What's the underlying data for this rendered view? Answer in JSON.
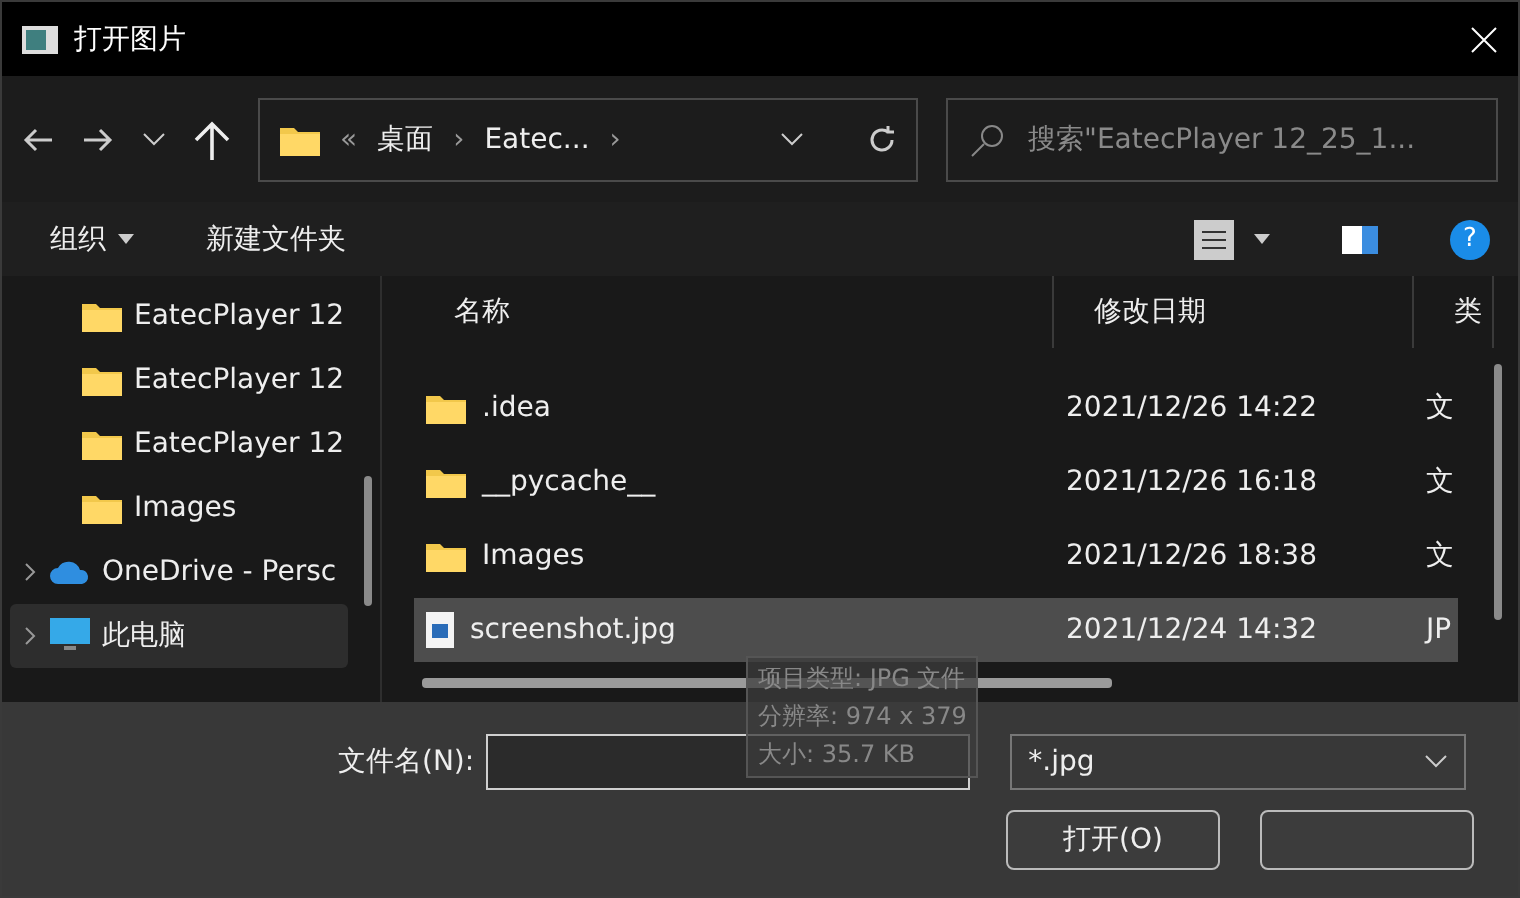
{
  "window": {
    "title": "打开图片"
  },
  "address": {
    "segments": [
      "«",
      "桌面",
      "›",
      "Eatec...",
      "›"
    ]
  },
  "search": {
    "placeholder": "搜索\"EatecPlayer 12_25_1..."
  },
  "toolbar": {
    "organize": "组织",
    "new_folder": "新建文件夹"
  },
  "sidebar": {
    "items": [
      {
        "kind": "folder",
        "label": "EatecPlayer 12",
        "selected": false
      },
      {
        "kind": "folder",
        "label": "EatecPlayer 12",
        "selected": false
      },
      {
        "kind": "folder",
        "label": "EatecPlayer 12",
        "selected": false
      },
      {
        "kind": "folder",
        "label": "Images",
        "selected": false
      },
      {
        "kind": "cloud",
        "label": "OneDrive - Persc",
        "selected": false
      },
      {
        "kind": "computer",
        "label": "此电脑",
        "selected": true
      }
    ]
  },
  "table": {
    "columns": [
      "名称",
      "修改日期",
      "类"
    ],
    "rows": [
      {
        "kind": "folder",
        "name": ".idea",
        "date": "2021/12/26 14:22",
        "type": "文",
        "selected": false
      },
      {
        "kind": "folder",
        "name": "__pycache__",
        "date": "2021/12/26 16:18",
        "type": "文",
        "selected": false
      },
      {
        "kind": "folder",
        "name": "Images",
        "date": "2021/12/26 18:38",
        "type": "文",
        "selected": false
      },
      {
        "kind": "image",
        "name": "screenshot.jpg",
        "date": "2021/12/24 14:32",
        "type": "JP",
        "selected": true
      }
    ]
  },
  "tooltip": [
    "项目类型: JPG 文件",
    "分辨率: 974 x 379",
    "大小: 35.7 KB"
  ],
  "help": "?",
  "footer": {
    "filename_label": "文件名(N):",
    "filter": "*.jpg",
    "open_button": "打开(O)"
  }
}
